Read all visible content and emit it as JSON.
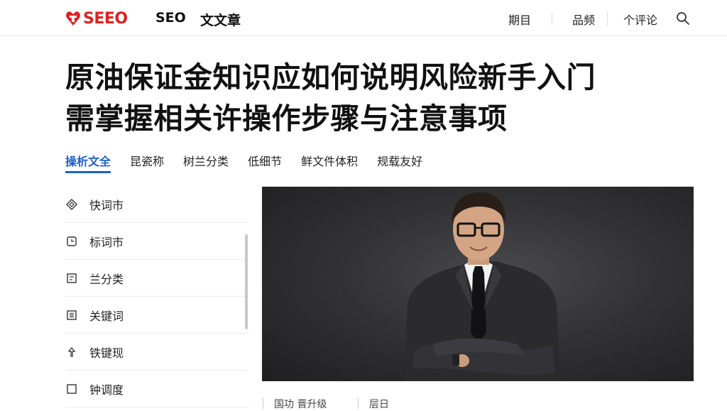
{
  "header": {
    "logo_text": "SEEO",
    "brand_sub": "SEO",
    "brand_sub2": "文文章",
    "nav": [
      "期目",
      "品频",
      "个评论"
    ],
    "accent_color": "#e02020",
    "search_icon": "search-icon"
  },
  "article": {
    "title_line1": "原油保证金知识应如何说明风险新手入门",
    "title_line2": "需掌握相关许操作步骤与注意事项"
  },
  "tabs": [
    {
      "label": "操析文全",
      "active": true
    },
    {
      "label": "昆瓷称",
      "active": false
    },
    {
      "label": "树兰分类",
      "active": false
    },
    {
      "label": "低细节",
      "active": false
    },
    {
      "label": "鲜文件体积",
      "active": false
    },
    {
      "label": "规载友好",
      "active": false
    }
  ],
  "tab_active_color": "#1e5fc8",
  "sidebar": {
    "items": [
      {
        "label": "快词市",
        "icon": "diamond-icon"
      },
      {
        "label": "标词市",
        "icon": "clock-icon"
      },
      {
        "label": "兰分类",
        "icon": "document-icon"
      },
      {
        "label": "关键词",
        "icon": "list-icon"
      },
      {
        "label": "铁键现",
        "icon": "pin-icon"
      },
      {
        "label": "钟调度",
        "icon": "document-icon"
      }
    ]
  },
  "meta": {
    "item1": "国功 晋升级",
    "item2": "层日"
  }
}
